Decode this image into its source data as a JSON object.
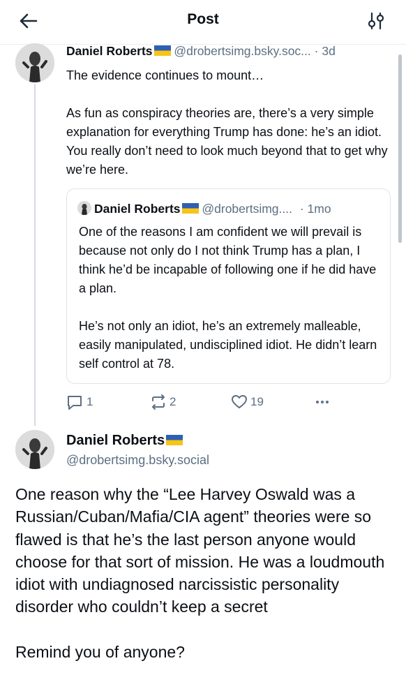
{
  "header": {
    "title": "Post",
    "back_icon": "arrow-left-icon",
    "filter_icon": "sliders-icon"
  },
  "reply_parent": {
    "author_name": "Daniel Roberts",
    "author_flag": "ukraine-flag-icon",
    "author_handle": "@drobertsimg.bsky.soc...",
    "timestamp": "· 3d",
    "paragraphs": [
      "The evidence continues to mount…",
      "As fun as conspiracy theories are, there’s a very simple explanation for everything Trump has done: he’s an idiot. You really don’t need to look much beyond that to get why we’re here."
    ],
    "quote": {
      "author_name": "Daniel Roberts",
      "author_flag": "ukraine-flag-icon",
      "author_handle": "@drobertsimg....",
      "timestamp": "· 1mo",
      "paragraphs": [
        "One of the reasons I am confident we will prevail is because not only do I not think Trump has a plan, I think he’d be incapable of following one if he did have a plan.",
        "He’s not only an idiot, he’s an extremely malleable, easily manipulated, undisciplined idiot. He didn’t learn self control at 78."
      ]
    },
    "actions": {
      "replies": "1",
      "reposts": "2",
      "likes": "19"
    }
  },
  "main_post": {
    "author_name": "Daniel Roberts",
    "author_flag": "ukraine-flag-icon",
    "author_handle": "@drobertsimg.bsky.social",
    "paragraphs": [
      "One reason why the “Lee Harvey Oswald was a Russian/Cuban/Mafia/CIA agent” theories were so flawed is that he’s the last person anyone would choose for that sort of mission. He was a loudmouth idiot with undiagnosed narcissistic personality disorder who couldn’t keep a secret",
      "Remind you of anyone?"
    ]
  },
  "colors": {
    "text": "#0b0f14",
    "muted": "#5c6f83",
    "thread_line": "#d4dbe2",
    "border": "#dfe4ea",
    "flag_blue": "#2f5fb3",
    "flag_yellow": "#f5c518"
  }
}
